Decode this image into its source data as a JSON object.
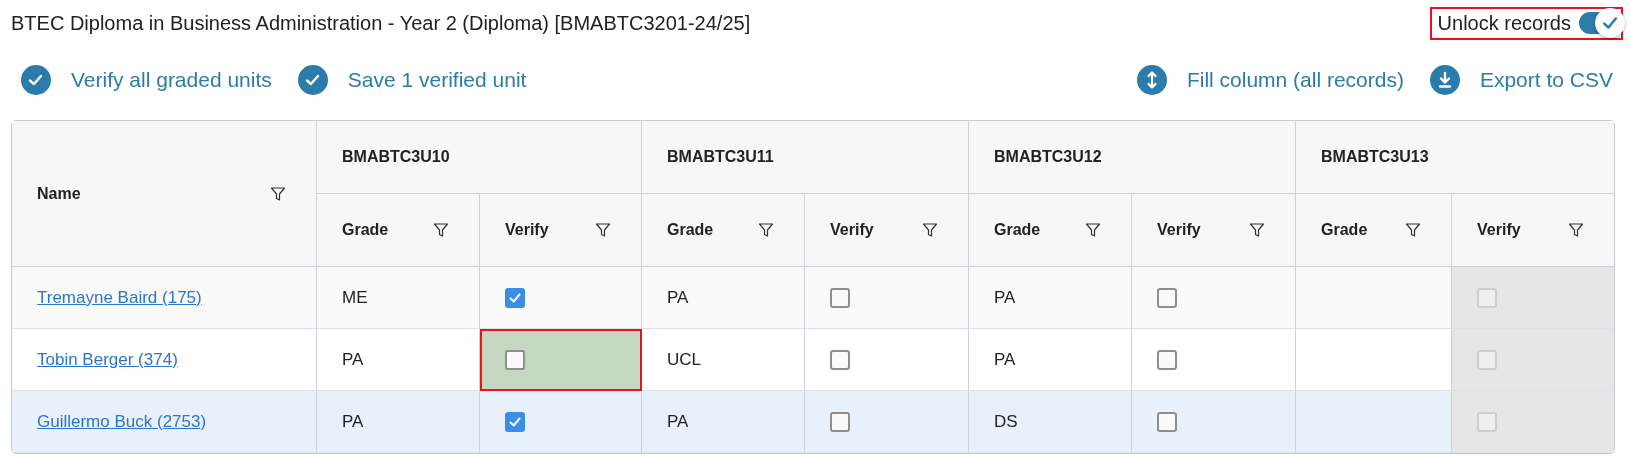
{
  "title": "BTEC Diploma in Business Administration - Year 2 (Diploma) [BMABTC3201-24/25]",
  "unlock": {
    "label": "Unlock records",
    "on": true,
    "highlighted": true
  },
  "actions_left": [
    {
      "label": "Verify all graded units"
    },
    {
      "label": "Save 1 verified unit"
    }
  ],
  "actions_right": [
    {
      "label": "Fill column (all records)"
    },
    {
      "label": "Export to CSV"
    }
  ],
  "table": {
    "name_header": "Name",
    "units": [
      {
        "code": "BMABTC3U10",
        "grade_header": "Grade",
        "verify_header": "Verify"
      },
      {
        "code": "BMABTC3U11",
        "grade_header": "Grade",
        "verify_header": "Verify"
      },
      {
        "code": "BMABTC3U12",
        "grade_header": "Grade",
        "verify_header": "Verify"
      },
      {
        "code": "BMABTC3U13",
        "grade_header": "Grade",
        "verify_header": "Verify"
      }
    ],
    "rows": [
      {
        "name": "Tremayne Baird (175)",
        "selected": false,
        "cells": [
          {
            "grade": "ME",
            "verified": true,
            "disabled": false,
            "highlighted": false
          },
          {
            "grade": "PA",
            "verified": false,
            "disabled": false,
            "highlighted": false
          },
          {
            "grade": "PA",
            "verified": false,
            "disabled": false,
            "highlighted": false
          },
          {
            "verified": false,
            "disabled": true,
            "highlighted": false
          }
        ]
      },
      {
        "name": "Tobin Berger (374)",
        "selected": false,
        "cells": [
          {
            "grade": "PA",
            "verified": false,
            "disabled": false,
            "highlighted": true
          },
          {
            "grade": "UCL",
            "verified": false,
            "disabled": false,
            "highlighted": false
          },
          {
            "grade": "PA",
            "verified": false,
            "disabled": false,
            "highlighted": false
          },
          {
            "verified": false,
            "disabled": true,
            "highlighted": false
          }
        ]
      },
      {
        "name": "Guillermo Buck (2753)",
        "selected": true,
        "cells": [
          {
            "grade": "PA",
            "verified": true,
            "disabled": false,
            "highlighted": false
          },
          {
            "grade": "PA",
            "verified": false,
            "disabled": false,
            "highlighted": false
          },
          {
            "grade": "DS",
            "verified": false,
            "disabled": false,
            "highlighted": false
          },
          {
            "verified": false,
            "disabled": true,
            "highlighted": false
          }
        ]
      }
    ]
  }
}
